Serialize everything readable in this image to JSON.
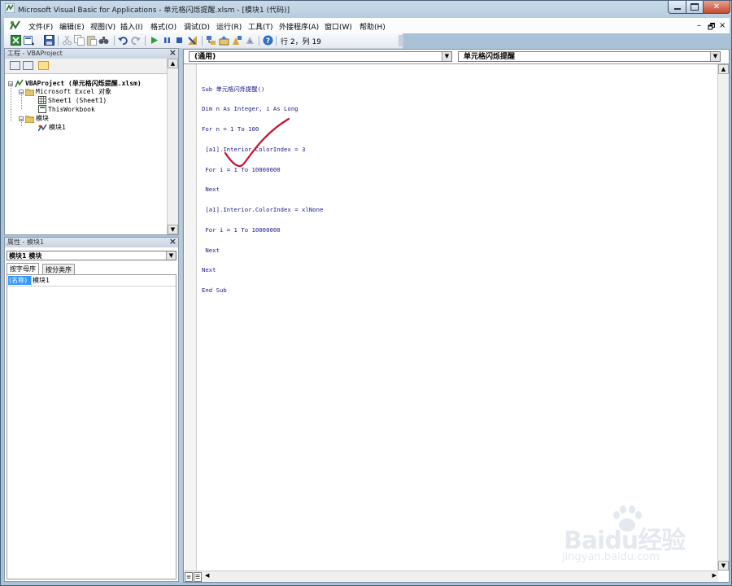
{
  "window": {
    "title": "Microsoft Visual Basic for Applications - 单元格闪烁提醒.xlsm - [模块1 (代码)]",
    "controls": {
      "minimize": "▬",
      "maximize": "▣",
      "close": "✕"
    }
  },
  "menu": {
    "items": [
      "文件(F)",
      "编辑(E)",
      "视图(V)",
      "插入(I)",
      "格式(O)",
      "调试(D)",
      "运行(R)",
      "工具(T)",
      "外接程序(A)",
      "窗口(W)",
      "帮助(H)"
    ],
    "mdi": {
      "minimize": "–",
      "restore": "🗗",
      "close": "×"
    }
  },
  "toolbar": {
    "icons": [
      "excel-icon",
      "insert-module-icon",
      "save-icon",
      "cut-icon",
      "copy-icon",
      "paste-icon",
      "find-icon",
      "undo-icon",
      "redo-icon",
      "run-icon",
      "break-icon",
      "reset-icon",
      "design-mode-icon",
      "project-explorer-icon",
      "properties-icon",
      "object-browser-icon",
      "toolbox-icon",
      "help-icon"
    ],
    "position": "行 2，列 19"
  },
  "project": {
    "title": "工程 - VBAProject",
    "close": "×",
    "tree": [
      {
        "label": "VBAProject (单元格闪烁提醒.xlsm)",
        "bold": true
      },
      {
        "label": "Microsoft Excel 对象",
        "bold": false
      },
      {
        "label": "Sheet1 (Sheet1)",
        "bold": false
      },
      {
        "label": "ThisWorkbook",
        "bold": false
      },
      {
        "label": "模块",
        "bold": false
      },
      {
        "label": "模块1",
        "bold": false
      }
    ]
  },
  "properties": {
    "title": "属性 - 模块1",
    "close": "×",
    "object": "模块1 模块",
    "tabs": [
      "按字母序",
      "按分类序"
    ],
    "rows": [
      {
        "key": "(名称)",
        "value": "模块1"
      }
    ]
  },
  "code": {
    "object_combo": "(通用)",
    "proc_combo": "单元格闪烁提醒",
    "lines": [
      "Sub 单元格闪烁提醒()",
      "Dim n As Integer, i As Long",
      "For n = 1 To 100",
      " [a1].Interior.ColorIndex = 3",
      " For i = 1 To 10000000",
      " Next",
      " [a1].Interior.ColorIndex = xlNone",
      " For i = 1 To 10000000",
      " Next",
      "Next",
      "End Sub"
    ]
  },
  "watermark": {
    "brand": "Baidu经验",
    "url": "jingyan.baidu.com"
  },
  "colors": {
    "selection": "#3399ff",
    "annotation": "#c8102e",
    "code_text": "#1a1a8a"
  }
}
